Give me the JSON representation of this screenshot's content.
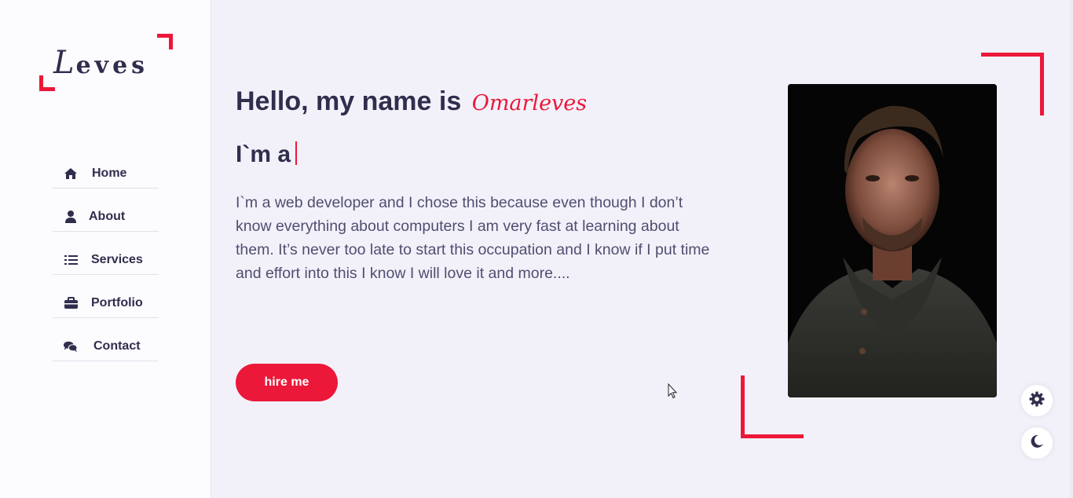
{
  "logo": {
    "first_letter": "L",
    "rest": "eves"
  },
  "colors": {
    "accent": "#ec1839",
    "text": "#302e4d",
    "sidebar_bg": "#fcfbfe",
    "main_bg": "#f2f1fa"
  },
  "nav": [
    {
      "label": "Home",
      "icon": "home-icon"
    },
    {
      "label": "About",
      "icon": "user-icon"
    },
    {
      "label": "Services",
      "icon": "list-icon"
    },
    {
      "label": "Portfolio",
      "icon": "briefcase-icon"
    },
    {
      "label": "Contact",
      "icon": "comments-icon"
    }
  ],
  "hero": {
    "greeting": "Hello, my name is",
    "name": "Omarleves",
    "typing_prefix": "I`m a",
    "description": "I`m a web developer and I chose this because even though I don’t know everything about computers I am very fast at learning about them. It’s never too late to start this occupation and I know if I put time and effort into this I know I will love it and more....",
    "hire_button": "hire me"
  },
  "controls": {
    "settings_icon": "gear-icon",
    "theme_icon": "moon-icon"
  }
}
